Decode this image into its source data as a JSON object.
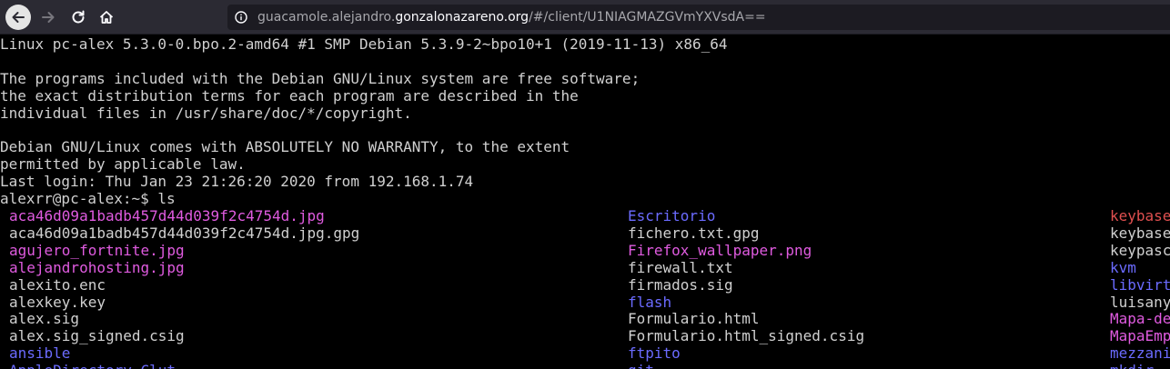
{
  "browser": {
    "url_prefix": "guacamole.alejandro.",
    "url_domain": "gonzalonazareno.org",
    "url_suffix": "/#/client/U1NIAGMAZGVmYXVsdA=="
  },
  "terminal": {
    "lines": [
      "Linux pc-alex 5.3.0-0.bpo.2-amd64 #1 SMP Debian 5.3.9-2~bpo10+1 (2019-11-13) x86_64",
      "",
      "The programs included with the Debian GNU/Linux system are free software;",
      "the exact distribution terms for each program are described in the",
      "individual files in /usr/share/doc/*/copyright.",
      "",
      "Debian GNU/Linux comes with ABSOLUTELY NO WARRANTY, to the extent",
      "permitted by applicable law.",
      "Last login: Thu Jan 23 21:26:20 2020 from 192.168.1.74",
      "alexrr@pc-alex:~$ ls"
    ],
    "ls_columns": [
      [
        {
          "name": "aca46d09a1badb457d44d039f2c4754d.jpg",
          "kind": "image"
        },
        {
          "name": "aca46d09a1badb457d44d039f2c4754d.jpg.gpg",
          "kind": "file"
        },
        {
          "name": "agujero_fortnite.jpg",
          "kind": "image"
        },
        {
          "name": "alejandrohosting.jpg",
          "kind": "image"
        },
        {
          "name": "alexito.enc",
          "kind": "file"
        },
        {
          "name": "alexkey.key",
          "kind": "file"
        },
        {
          "name": "alex.sig",
          "kind": "file"
        },
        {
          "name": "alex.sig_signed.csig",
          "kind": "file"
        },
        {
          "name": "ansible",
          "kind": "dir"
        },
        {
          "name": "AppleDirectory_Clut",
          "kind": "dir"
        }
      ],
      [
        {
          "name": "Escritorio",
          "kind": "dir"
        },
        {
          "name": "fichero.txt.gpg",
          "kind": "file"
        },
        {
          "name": "Firefox_wallpaper.png",
          "kind": "image"
        },
        {
          "name": "firewall.txt",
          "kind": "file"
        },
        {
          "name": "firmados.sig",
          "kind": "file"
        },
        {
          "name": "flash",
          "kind": "dir"
        },
        {
          "name": "Formulario.html",
          "kind": "file"
        },
        {
          "name": "Formulario.html_signed.csig",
          "kind": "file"
        },
        {
          "name": "ftpito",
          "kind": "dir"
        },
        {
          "name": "git",
          "kind": "dir"
        }
      ],
      [
        {
          "name": "keybase",
          "kind": "archive"
        },
        {
          "name": "keybase",
          "kind": "file"
        },
        {
          "name": "keypasc",
          "kind": "file"
        },
        {
          "name": "kvm",
          "kind": "dir"
        },
        {
          "name": "libvirt",
          "kind": "dir"
        },
        {
          "name": "luisany",
          "kind": "file"
        },
        {
          "name": "Mapa-de",
          "kind": "image"
        },
        {
          "name": "MapaEmp",
          "kind": "image"
        },
        {
          "name": "mezzani",
          "kind": "dir"
        },
        {
          "name": "mkdir",
          "kind": "dir"
        }
      ]
    ]
  }
}
